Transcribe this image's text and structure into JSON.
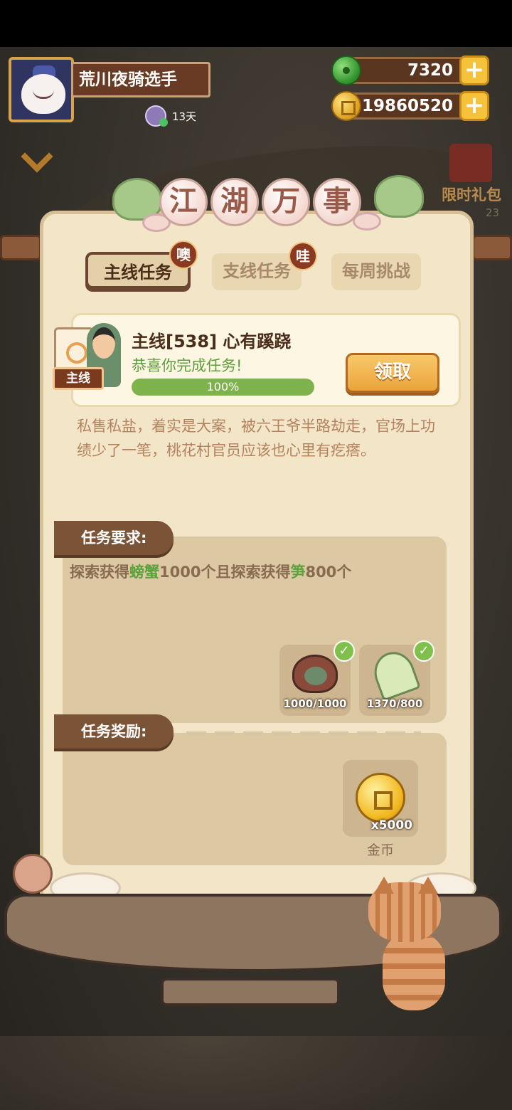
{
  "profile": {
    "name": "荒川夜骑选手",
    "days": "13天"
  },
  "currency": {
    "jade": "7320",
    "coins": "19860520"
  },
  "side_event": {
    "label": "限时礼包",
    "timer": "23"
  },
  "panel": {
    "title_chars": [
      "江",
      "湖",
      "万",
      "事"
    ]
  },
  "tabs": [
    {
      "label": "主线任务",
      "badge": "噢",
      "active": true
    },
    {
      "label": "支线任务",
      "badge": "哇",
      "active": false
    },
    {
      "label": "每周挑战",
      "badge": "",
      "active": false
    }
  ],
  "quest": {
    "tag": "主线",
    "title": "主线[538] 心有蹊跷",
    "subtitle": "恭喜你完成任务!",
    "progress_text": "100%",
    "progress_value": 1.0,
    "claim_label": "领取",
    "description": "私售私盐，着实是大案，被六王爷半路劫走，官场上功绩少了一笔，桃花村官员应该也心里有疙瘩。"
  },
  "requirements": {
    "header": "任务要求:",
    "text_parts": [
      "探索获得",
      "螃蟹",
      "1000个且探索获得",
      "笋",
      "800个"
    ],
    "items": [
      {
        "icon": "crab-icon",
        "count": "1000/1000",
        "done": true
      },
      {
        "icon": "bamboo-shoot-icon",
        "count": "1370/800",
        "done": true
      }
    ]
  },
  "rewards": {
    "header": "任务奖励:",
    "items": [
      {
        "icon": "gold-coin-icon",
        "quantity": "x5000",
        "name": "金币"
      }
    ]
  },
  "colors": {
    "highlight_green": "#5aa23a",
    "panel_bg": "#f3e6c8",
    "claim_button": "#eaa43a"
  }
}
